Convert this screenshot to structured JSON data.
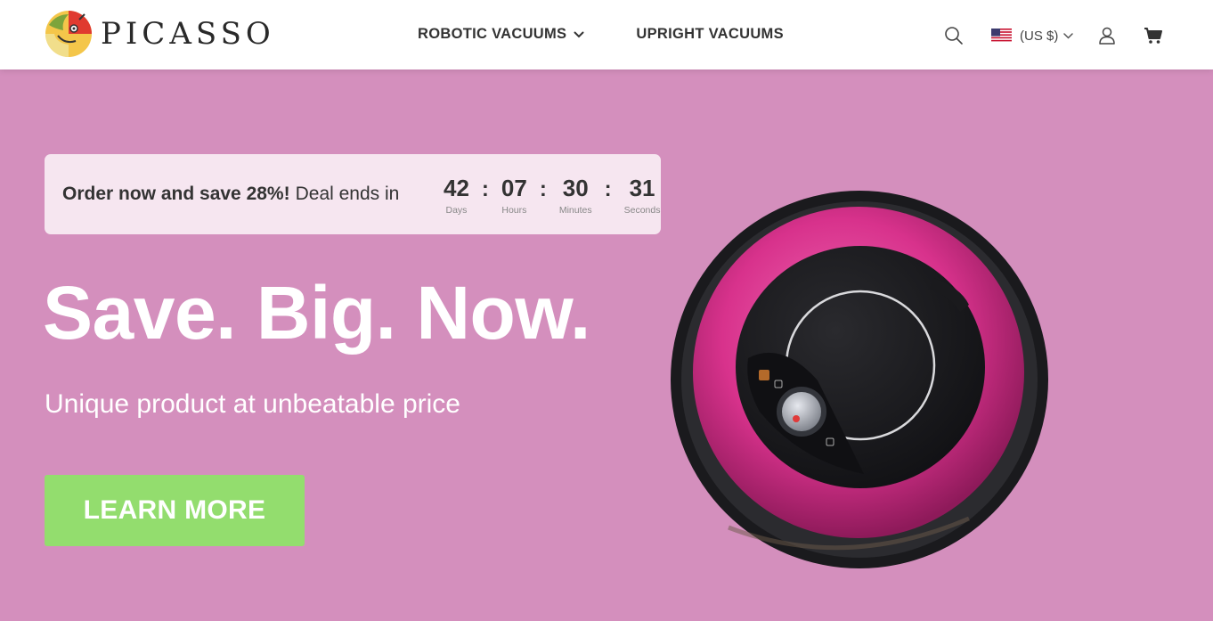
{
  "brand": {
    "name": "PICASSO",
    "logo_icon": "picasso-face-logo"
  },
  "nav": {
    "items": [
      {
        "label": "ROBOTIC VACUUMS",
        "has_dropdown": true
      },
      {
        "label": "UPRIGHT VACUUMS",
        "has_dropdown": false
      }
    ]
  },
  "tools": {
    "search_icon": "search-icon",
    "currency_label": "(US $)",
    "flag_icon": "us-flag-icon",
    "account_icon": "user-icon",
    "cart_icon": "cart-icon"
  },
  "promo": {
    "bold_text": "Order now and save 28%!",
    "rest_text": "Deal ends in",
    "countdown": [
      {
        "value": "42",
        "label": "Days"
      },
      {
        "value": "07",
        "label": "Hours"
      },
      {
        "value": "30",
        "label": "Minutes"
      },
      {
        "value": "31",
        "label": "Seconds"
      }
    ],
    "separator": ":"
  },
  "hero": {
    "headline": "Save. Big. Now.",
    "subline": "Unique product at unbeatable price",
    "cta_label": "LEARN MORE"
  },
  "colors": {
    "hero_background": "#d48fbd",
    "promo_background": "#f6e6f0",
    "cta_background": "#93dd6e",
    "robot_accent": "#d8328c"
  }
}
